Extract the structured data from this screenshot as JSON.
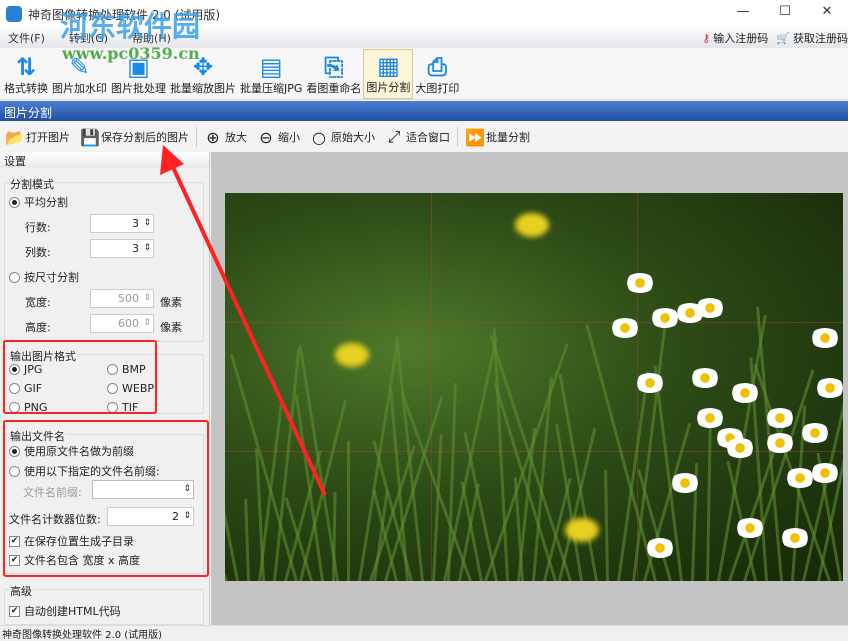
{
  "window": {
    "title": "神奇图像转换处理软件 2.0 (试用版)",
    "minimize": "—",
    "maximize": "☐",
    "close": "✕"
  },
  "menu": [
    "文件(F)",
    "转到(G)",
    "帮助(H)"
  ],
  "register": {
    "enter_code": "输入注册码",
    "get_code": "获取注册码"
  },
  "toolbar": [
    {
      "label": "格式转换",
      "icon": "convert-icon",
      "glyph": "⇅"
    },
    {
      "label": "图片加水印",
      "icon": "brush-icon",
      "glyph": "✎"
    },
    {
      "label": "图片批处理",
      "icon": "image-icon",
      "glyph": "▣"
    },
    {
      "label": "批量缩放图片",
      "icon": "move-icon",
      "glyph": "✥"
    },
    {
      "label": "批量压缩JPG",
      "icon": "jpg-file-icon",
      "glyph": "▤"
    },
    {
      "label": "看图重命名",
      "icon": "rename-icon",
      "glyph": "⎘"
    },
    {
      "label": "图片分割",
      "icon": "grid-icon",
      "glyph": "▦"
    },
    {
      "label": "大图打印",
      "icon": "printer-icon",
      "glyph": "⎙"
    }
  ],
  "section_title": "图片分割",
  "subtoolbar": {
    "open": "打开图片",
    "save": "保存分割后的图片",
    "zoom_in": "放大",
    "zoom_out": "缩小",
    "original": "原始大小",
    "fit": "适合窗口",
    "batch": "批量分割"
  },
  "settings": {
    "header": "设置",
    "split_mode": {
      "title": "分割模式",
      "even": "平均分割",
      "rows_label": "行数:",
      "rows": "3",
      "cols_label": "列数:",
      "cols": "3",
      "by_size": "按尺寸分割",
      "width_label": "宽度:",
      "width": "500",
      "height_label": "高度:",
      "height": "600",
      "unit": "像素"
    },
    "format": {
      "title": "输出图片格式",
      "options": [
        "JPG",
        "BMP",
        "GIF",
        "WEBP",
        "PNG",
        "TIF"
      ],
      "selected": "JPG"
    },
    "filename": {
      "title": "输出文件名",
      "use_original": "使用原文件名做为前缀",
      "use_custom": "使用以下指定的文件名前缀:",
      "prefix_label": "文件名前缀:",
      "prefix_value": "",
      "counter_label": "文件名计数器位数:",
      "counter": "2",
      "subdir": "在保存位置生成子目录",
      "include_size": "文件名包含 宽度 x 高度"
    },
    "advanced": {
      "title": "高级",
      "html": "自动创建HTML代码"
    }
  },
  "status": "神奇图像转换处理软件 2.0 (试用版)",
  "watermark": {
    "name": "河东软件园",
    "url": "www.pc0359.cn"
  },
  "colors": {
    "accent": "#1f4fa5",
    "highlight": "#ff2222"
  }
}
